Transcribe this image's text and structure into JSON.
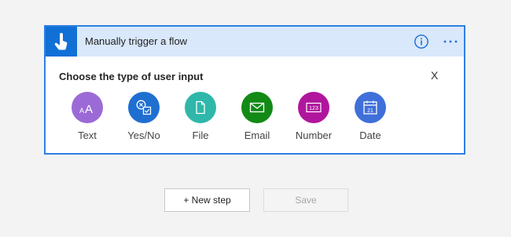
{
  "trigger": {
    "title": "Manually trigger a flow",
    "icon": "hand-tap-icon",
    "accent_color": "#1070d6",
    "header_color": "#d9e8fb"
  },
  "input_picker": {
    "prompt": "Choose the type of user input",
    "close_label": "X",
    "options": [
      {
        "label": "Text",
        "icon": "text-icon",
        "color": "#9c6ad6"
      },
      {
        "label": "Yes/No",
        "icon": "yes-no-icon",
        "color": "#1f6fd1"
      },
      {
        "label": "File",
        "icon": "file-icon",
        "color": "#2fb7a9"
      },
      {
        "label": "Email",
        "icon": "email-icon",
        "color": "#138a16"
      },
      {
        "label": "Number",
        "icon": "number-icon",
        "color": "#b0169d"
      },
      {
        "label": "Date",
        "icon": "calendar-icon",
        "color": "#3f6fd9",
        "glyph": "21"
      }
    ]
  },
  "actions": {
    "new_step_label": "+ New step",
    "save_label": "Save"
  }
}
